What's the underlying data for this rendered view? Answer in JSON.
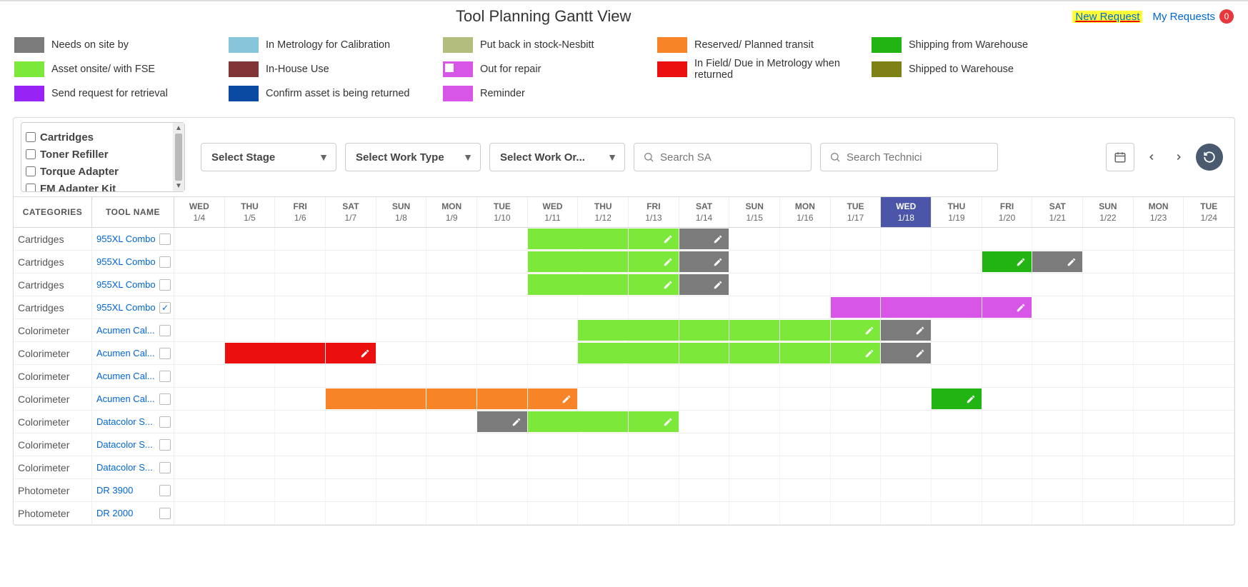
{
  "header": {
    "title": "Tool Planning Gantt View",
    "new_request": "New Request",
    "my_requests": "My Requests",
    "my_requests_count": "0"
  },
  "legend": [
    [
      {
        "label": "Needs on site by",
        "color": "c-grey"
      },
      {
        "label": "Asset onsite/ with FSE",
        "color": "c-green"
      },
      {
        "label": "Send request for retrieval",
        "color": "c-violet"
      }
    ],
    [
      {
        "label": "In Metrology for Calibration",
        "color": "c-cyan"
      },
      {
        "label": "In-House Use",
        "color": "c-maroon"
      },
      {
        "label": "Confirm asset is being returned",
        "color": "c-blue"
      }
    ],
    [
      {
        "label": "Put back in stock-Nesbitt",
        "color": "c-olive"
      },
      {
        "label": "Out for repair",
        "color": "c-magenta",
        "inner": true
      },
      {
        "label": "Reminder",
        "color": "c-magenta"
      }
    ],
    [
      {
        "label": "Reserved/ Planned transit",
        "color": "c-orange"
      },
      {
        "label": "In Field/ Due in Metrology when returned",
        "color": "c-red"
      }
    ],
    [
      {
        "label": "Shipping from Warehouse",
        "color": "c-darkgreen"
      },
      {
        "label": "Shipped to Warehouse",
        "color": "c-olivedark"
      }
    ]
  ],
  "filters": {
    "categories": [
      "Cartridges",
      "Toner Refiller",
      "Torque Adapter",
      "FM Adapter Kit"
    ],
    "stage": "Select Stage",
    "work_type": "Select Work Type",
    "work_order": "Select Work Or...",
    "search_sa_ph": "Search SA",
    "search_tech_ph": "Search Technici"
  },
  "columns": {
    "categories": "CATEGORIES",
    "tool": "TOOL NAME"
  },
  "days": [
    {
      "dow": "WED",
      "dom": "1/4"
    },
    {
      "dow": "THU",
      "dom": "1/5"
    },
    {
      "dow": "FRI",
      "dom": "1/6"
    },
    {
      "dow": "SAT",
      "dom": "1/7"
    },
    {
      "dow": "SUN",
      "dom": "1/8"
    },
    {
      "dow": "MON",
      "dom": "1/9"
    },
    {
      "dow": "TUE",
      "dom": "1/10"
    },
    {
      "dow": "WED",
      "dom": "1/11"
    },
    {
      "dow": "THU",
      "dom": "1/12"
    },
    {
      "dow": "FRI",
      "dom": "1/13"
    },
    {
      "dow": "SAT",
      "dom": "1/14"
    },
    {
      "dow": "SUN",
      "dom": "1/15"
    },
    {
      "dow": "MON",
      "dom": "1/16"
    },
    {
      "dow": "TUE",
      "dom": "1/17"
    },
    {
      "dow": "WED",
      "dom": "1/18",
      "today": true
    },
    {
      "dow": "THU",
      "dom": "1/19"
    },
    {
      "dow": "FRI",
      "dom": "1/20"
    },
    {
      "dow": "SAT",
      "dom": "1/21"
    },
    {
      "dow": "SUN",
      "dom": "1/22"
    },
    {
      "dow": "MON",
      "dom": "1/23"
    },
    {
      "dow": "TUE",
      "dom": "1/24"
    }
  ],
  "rows": [
    {
      "category": "Cartridges",
      "tool": "955XL Combo",
      "checked": false,
      "bars": [
        {
          "start": 7,
          "end": 10,
          "color": "c-green",
          "edit": true
        },
        {
          "start": 10,
          "end": 11,
          "color": "c-grey",
          "edit": true
        }
      ]
    },
    {
      "category": "Cartridges",
      "tool": "955XL Combo",
      "checked": false,
      "bars": [
        {
          "start": 7,
          "end": 10,
          "color": "c-green",
          "edit": true
        },
        {
          "start": 10,
          "end": 11,
          "color": "c-grey",
          "edit": true
        },
        {
          "start": 16,
          "end": 17,
          "color": "c-darkgreen",
          "edit": true
        },
        {
          "start": 17,
          "end": 18,
          "color": "c-grey",
          "edit": true
        }
      ]
    },
    {
      "category": "Cartridges",
      "tool": "955XL Combo",
      "checked": false,
      "bars": [
        {
          "start": 7,
          "end": 10,
          "color": "c-green",
          "edit": true
        },
        {
          "start": 10,
          "end": 11,
          "color": "c-grey",
          "edit": true
        }
      ]
    },
    {
      "category": "Cartridges",
      "tool": "955XL Combo",
      "checked": true,
      "bars": [
        {
          "start": 13,
          "end": 14,
          "color": "c-magenta"
        },
        {
          "start": 14,
          "end": 17,
          "color": "c-magenta",
          "edit": true
        }
      ]
    },
    {
      "category": "Colorimeter",
      "tool": "Acumen Cal...",
      "checked": false,
      "bars": [
        {
          "start": 8,
          "end": 14,
          "color": "c-green",
          "edit": true
        },
        {
          "start": 14,
          "end": 15,
          "color": "c-grey",
          "edit": true
        }
      ]
    },
    {
      "category": "Colorimeter",
      "tool": "Acumen Cal...",
      "checked": false,
      "bars": [
        {
          "start": 1,
          "end": 4,
          "color": "c-red",
          "edit": true
        },
        {
          "start": 8,
          "end": 14,
          "color": "c-green",
          "edit": true
        },
        {
          "start": 14,
          "end": 15,
          "color": "c-grey",
          "edit": true
        }
      ]
    },
    {
      "category": "Colorimeter",
      "tool": "Acumen Cal...",
      "checked": false,
      "bars": []
    },
    {
      "category": "Colorimeter",
      "tool": "Acumen Cal...",
      "checked": false,
      "bars": [
        {
          "start": 3,
          "end": 8,
          "color": "c-orange",
          "edit": true
        },
        {
          "start": 15,
          "end": 16,
          "color": "c-darkgreen",
          "edit": true
        }
      ]
    },
    {
      "category": "Colorimeter",
      "tool": "Datacolor S...",
      "checked": false,
      "bars": [
        {
          "start": 6,
          "end": 7,
          "color": "c-grey",
          "edit": true
        },
        {
          "start": 7,
          "end": 10,
          "color": "c-green",
          "edit": true
        }
      ]
    },
    {
      "category": "Colorimeter",
      "tool": "Datacolor S...",
      "checked": false,
      "bars": []
    },
    {
      "category": "Colorimeter",
      "tool": "Datacolor S...",
      "checked": false,
      "bars": []
    },
    {
      "category": "Photometer",
      "tool": "DR 3900",
      "checked": false,
      "bars": []
    },
    {
      "category": "Photometer",
      "tool": "DR 2000",
      "checked": false,
      "bars": []
    }
  ]
}
